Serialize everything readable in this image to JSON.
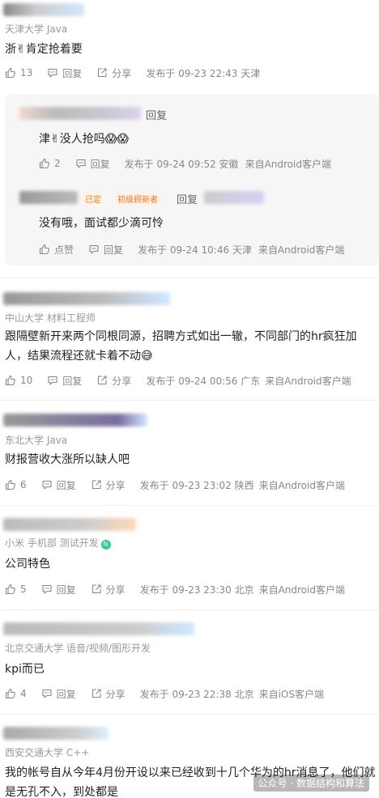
{
  "colors": {
    "text": "#222222",
    "meta": "#999999",
    "action": "#888888",
    "thread_bg": "#f6f6f7",
    "accent_green": "#2ecc8f",
    "badge_orange": "#e9792c"
  },
  "icons": {
    "like": "thumb-up-icon",
    "reply": "chat-bubble-icon",
    "share": "share-icon"
  },
  "comments": [
    {
      "school": "天津大学 Java",
      "text": "浙✌肯定抢着要",
      "likes": "13",
      "reply": "回复",
      "share": "分享",
      "time": "发布于 09-23 22:43 天津"
    },
    {
      "school": "中山大学 材料工程师",
      "text": "跟隔壁新开来两个同根同源，招聘方式如出一辙，不同部门的hr疯狂加人，结果流程还就卡着不动😅",
      "likes": "10",
      "reply": "回复",
      "share": "分享",
      "time": "发布于 09-24 00:56 广东",
      "source": "来自Android客户端"
    },
    {
      "school": "东北大学 Java",
      "text": "财报营收大涨所以缺人吧",
      "likes": "6",
      "reply": "回复",
      "share": "分享",
      "time": "发布于 09-23 23:02 陕西",
      "source": "来自Android客户端"
    },
    {
      "school": "小米 手机部 测试开发",
      "text": "公司特色",
      "likes": "5",
      "reply": "回复",
      "share": "分享",
      "time": "发布于 09-23 23:30 北京",
      "source": "来自Android客户端"
    },
    {
      "school": "北京交通大学 语音/视频/图形开发",
      "text": "kpi而已",
      "likes": "4",
      "reply": "回复",
      "share": "分享",
      "time": "发布于 09-23 22:38 北京",
      "source": "来自iOS客户端"
    },
    {
      "school": "西安交通大学 C++",
      "text": "我的帐号自从今年4月份开设以来已经收到十几个华为的hr消息了，他们就是无孔不入，到处都是"
    }
  ],
  "thread": {
    "replies": [
      {
        "reply_label": "回复",
        "text": "津✌没人抢吗😱😱",
        "likes": "2",
        "reply": "回复",
        "time": "发布于 09-24 09:52 安徽",
        "source": "来自Android客户端"
      },
      {
        "badge1": "已定",
        "badge2": "初级顾新者",
        "reply_label": "回复",
        "text": "没有哦，面试都少滴可怜",
        "likes": "点赞",
        "reply": "回复",
        "time": "发布于 09-24 10:46 天津",
        "source": "来自Android客户端"
      }
    ]
  },
  "badge_n": "N",
  "watermark": "公众号 · 数据结构和算法"
}
